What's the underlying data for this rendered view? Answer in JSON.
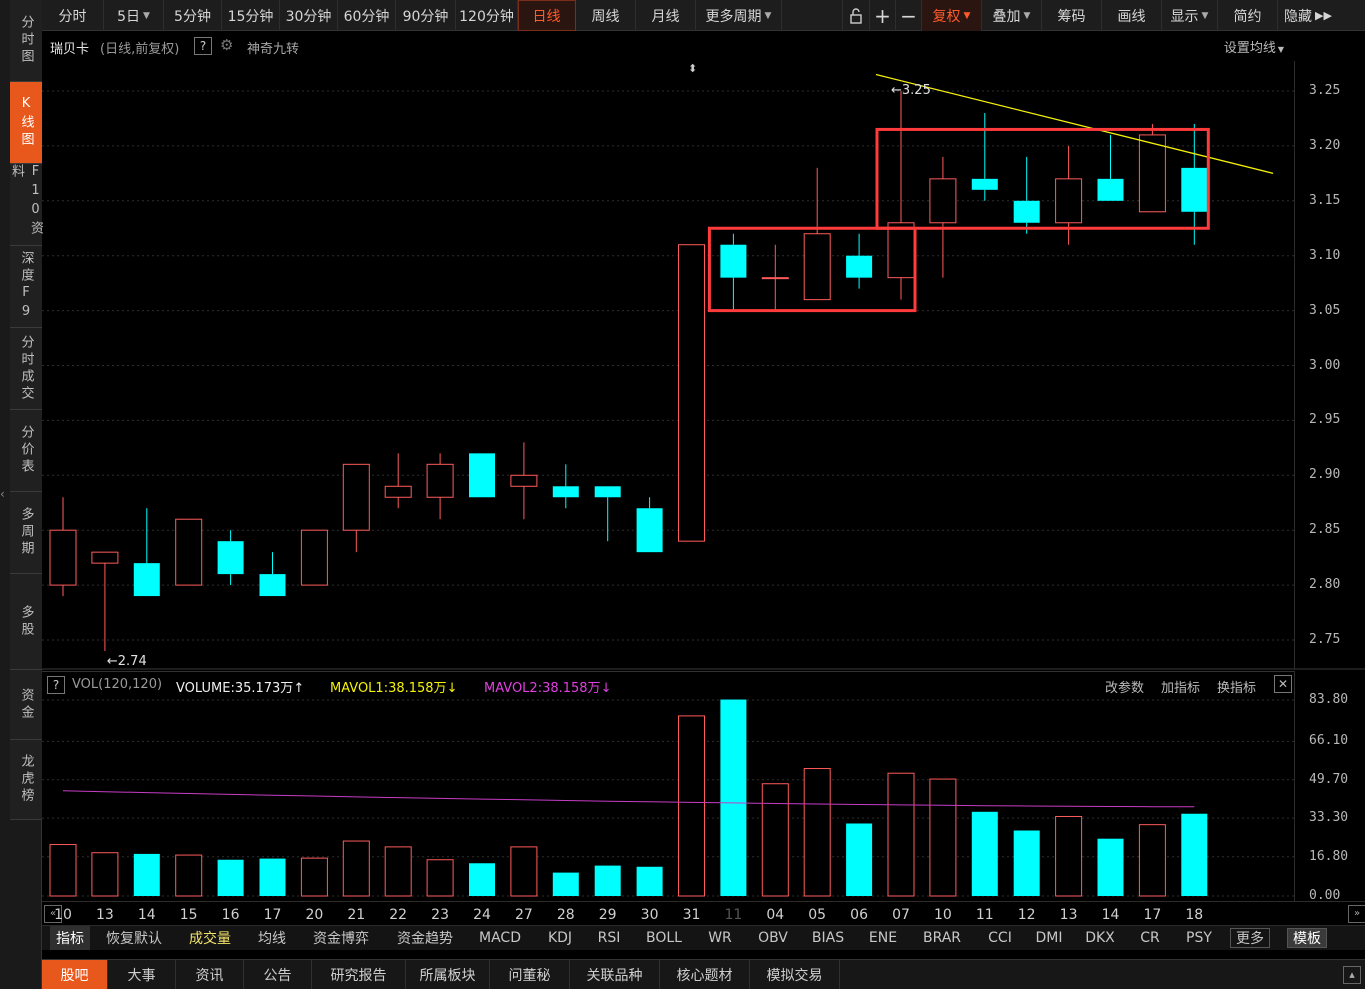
{
  "sidebar": {
    "items": [
      {
        "label": "分时图",
        "name": "sidebar-item-fenshi",
        "active": false
      },
      {
        "label": "K线图",
        "name": "sidebar-item-kline",
        "active": true
      },
      {
        "label": "F10资料",
        "name": "sidebar-item-f10",
        "active": false
      },
      {
        "label": "深度F9",
        "name": "sidebar-item-f9",
        "active": false
      },
      {
        "label": "分时成交",
        "name": "sidebar-item-fenshi-chengjiao",
        "active": false
      },
      {
        "label": "分价表",
        "name": "sidebar-item-fenjia",
        "active": false
      },
      {
        "label": "多周期",
        "name": "sidebar-item-multi-period",
        "active": false
      },
      {
        "label": "多股",
        "name": "sidebar-item-multi-stock",
        "active": false
      },
      {
        "label": "资金",
        "name": "sidebar-item-fund",
        "active": false
      },
      {
        "label": "龙虎榜",
        "name": "sidebar-item-longhubang",
        "active": false
      }
    ]
  },
  "toolbar": {
    "periods": [
      "分时",
      "5日",
      "5分钟",
      "15分钟",
      "30分钟",
      "60分钟",
      "90分钟",
      "120分钟",
      "日线",
      "周线",
      "月线",
      "更多周期"
    ],
    "active_period": "日线",
    "tools": [
      "复权",
      "叠加",
      "筹码",
      "画线",
      "显示",
      "简约",
      "隐藏"
    ],
    "icons": [
      "unlock-icon",
      "zoom-in-icon",
      "zoom-out-icon"
    ]
  },
  "header": {
    "stock_name": "瑞贝卡",
    "period_info": "(日线,前复权)",
    "help": "?",
    "indicator_name": "神奇九转",
    "ma_setting": "设置均线"
  },
  "price_axis": {
    "ticks": [
      "3.25",
      "3.20",
      "3.15",
      "3.10",
      "3.05",
      "3.00",
      "2.95",
      "2.90",
      "2.85",
      "2.80",
      "2.75"
    ]
  },
  "volume_axis": {
    "ticks": [
      "83.80",
      "66.10",
      "49.70",
      "33.30",
      "16.80",
      "0.00"
    ]
  },
  "indicator_header": {
    "help": "?",
    "name": "VOL(120,120)",
    "volume": "VOLUME:35.173万",
    "mavol1": "MAVOL1:38.158万",
    "mavol2": "MAVOL2:38.158万",
    "actions": [
      "改参数",
      "加指标",
      "换指标"
    ],
    "close": "✕"
  },
  "chart_data": {
    "type": "candlestick",
    "title": "瑞贝卡",
    "ylim": [
      2.72,
      3.28
    ],
    "dates": [
      "10",
      "13",
      "14",
      "15",
      "16",
      "17",
      "20",
      "21",
      "22",
      "23",
      "24",
      "27",
      "28",
      "29",
      "30",
      "31",
      "11",
      "04",
      "05",
      "06",
      "07",
      "10",
      "11",
      "12",
      "13",
      "14",
      "17",
      "18"
    ],
    "highlight_date": "11",
    "open": [
      2.8,
      2.82,
      2.82,
      2.8,
      2.84,
      2.81,
      2.8,
      2.85,
      2.88,
      2.88,
      2.92,
      2.89,
      2.89,
      2.89,
      2.87,
      2.84,
      3.11,
      3.08,
      3.06,
      3.1,
      3.08,
      3.13,
      3.17,
      3.15,
      3.13,
      3.17,
      3.14,
      3.18
    ],
    "high": [
      2.88,
      2.83,
      2.87,
      2.85,
      2.85,
      2.83,
      2.84,
      2.88,
      2.92,
      2.92,
      2.92,
      2.93,
      2.91,
      2.89,
      2.88,
      3.11,
      3.12,
      3.11,
      3.18,
      3.12,
      3.25,
      3.19,
      3.23,
      3.19,
      3.2,
      3.21,
      3.22,
      3.22
    ],
    "low": [
      2.79,
      2.74,
      2.79,
      2.8,
      2.8,
      2.79,
      2.8,
      2.83,
      2.87,
      2.86,
      2.88,
      2.86,
      2.87,
      2.84,
      2.83,
      2.84,
      3.05,
      3.05,
      3.06,
      3.07,
      3.06,
      3.08,
      3.15,
      3.12,
      3.11,
      3.15,
      3.14,
      3.11
    ],
    "close": [
      2.85,
      2.83,
      2.79,
      2.86,
      2.81,
      2.79,
      2.85,
      2.91,
      2.89,
      2.91,
      2.88,
      2.9,
      2.88,
      2.88,
      2.83,
      3.11,
      3.08,
      3.08,
      3.12,
      3.08,
      3.13,
      3.17,
      3.16,
      3.13,
      3.17,
      3.15,
      3.21,
      3.14
    ],
    "volume": [
      22,
      18.5,
      18,
      17.5,
      15.5,
      16,
      16.2,
      23.5,
      21,
      15.5,
      14,
      21,
      10,
      13,
      12.5,
      77,
      84,
      48,
      54.5,
      31,
      52.5,
      50,
      36,
      28,
      34,
      24.5,
      30.5,
      35.173
    ],
    "ma_volume_start": 45,
    "ma_volume_end": 38.158,
    "low_marker": {
      "date_index": 1,
      "label": "←2.74"
    },
    "high_marker": {
      "date_index": 20,
      "label": "←3.25"
    },
    "trendline": {
      "start": {
        "date_index": 20,
        "price": 3.265
      },
      "end": {
        "date_index": 29,
        "price": 3.175
      }
    },
    "rectangles": [
      {
        "from_index": 16,
        "to_index": 20,
        "top": 3.125,
        "bottom": 3.05
      },
      {
        "from_index": 20,
        "to_index": 27,
        "top": 3.215,
        "bottom": 3.125
      }
    ],
    "colors": {
      "up": "#ff5b5b",
      "down": "#00ffff",
      "trendline": "#f5f20a",
      "ma": "#c63cc6",
      "box": "#ff3b3b",
      "grid": "#2e2e2e"
    }
  },
  "indicator_tabs": {
    "items": [
      "指标",
      "恢复默认",
      "成交量",
      "均线",
      "资金博弈",
      "资金趋势",
      "MACD",
      "KDJ",
      "RSI",
      "BOLL",
      "WR",
      "OBV",
      "BIAS",
      "ENE",
      "BRAR",
      "CCI",
      "DMI",
      "DKX",
      "CR",
      "PSY",
      "更多",
      "模板"
    ]
  },
  "bottom_bar": {
    "items": [
      "股吧",
      "大事",
      "资讯",
      "公告",
      "研究报告",
      "所属板块",
      "问董秘",
      "关联品种",
      "核心题材",
      "模拟交易"
    ]
  }
}
